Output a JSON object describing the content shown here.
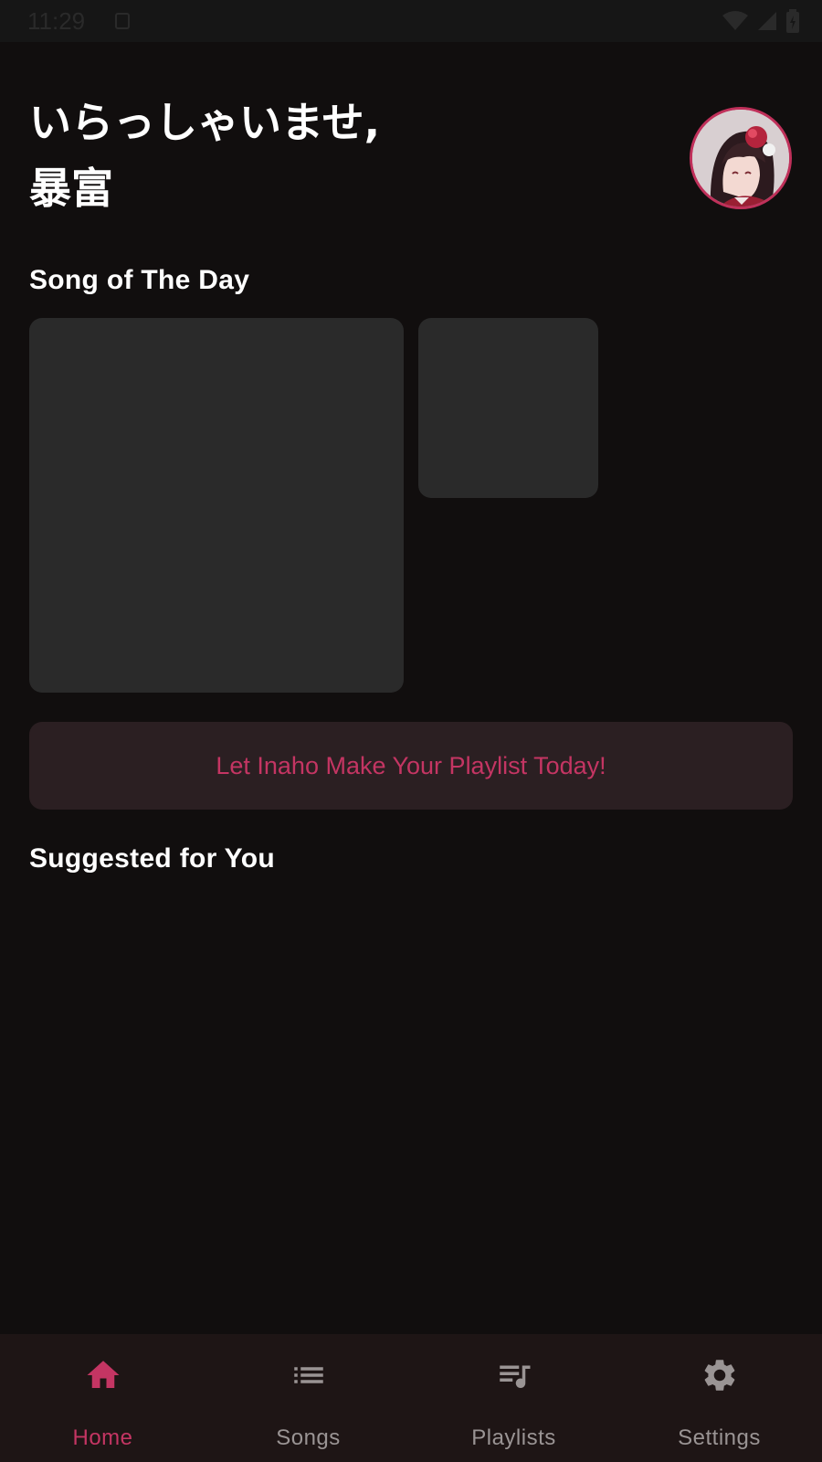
{
  "status_bar": {
    "time": "11:29"
  },
  "header": {
    "greeting_line1": "いらっしゃいませ,",
    "greeting_line2": "暴富",
    "avatar": "user-avatar-anime-girl"
  },
  "song_of_the_day": {
    "title": "Song of The Day"
  },
  "playlist_cta": {
    "label": "Let Inaho Make Your Playlist Today!"
  },
  "suggested": {
    "title": "Suggested for You"
  },
  "bottom_nav": {
    "items": [
      {
        "label": "Home",
        "icon": "home-icon",
        "active": true
      },
      {
        "label": "Songs",
        "icon": "list-icon",
        "active": false
      },
      {
        "label": "Playlists",
        "icon": "playlist-music-icon",
        "active": false
      },
      {
        "label": "Settings",
        "icon": "gear-icon",
        "active": false
      }
    ]
  },
  "colors": {
    "background": "#110e0e",
    "accent": "#c43563",
    "card": "#2a2a2a",
    "nav_background": "#1e1515",
    "cta_background": "#2b1f22",
    "inactive": "#9a9494"
  }
}
